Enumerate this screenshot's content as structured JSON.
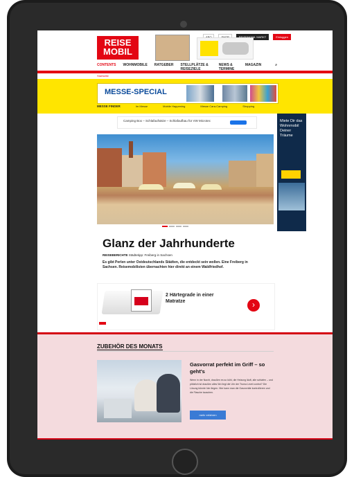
{
  "header": {
    "logo": "REISE MOBIL",
    "top_links": [
      "ABO",
      "SHOP",
      "REISEMOBIL MARKT",
      "Einloggen"
    ],
    "nav": [
      "CONTENTS",
      "WOHNMOBILE",
      "RATGEBER",
      "STELLPLÄTZE & REISEZIELE",
      "NEWS & TERMINE",
      "MAGAZIN"
    ],
    "subnav": "Startseite"
  },
  "messe": {
    "title": "MESSE-SPECIAL",
    "bar": [
      "MESSE FINDER",
      "Im Messe",
      "Mobile Happening",
      "Messe Cara-Camping",
      "Shopping"
    ]
  },
  "ad_bar": {
    "text": "Camping Box – Schlafaufsätze – Schlafaufbau für VW Microtec"
  },
  "skyscraper": {
    "text": "Miete Dir das Wohnmobil Deiner Träume"
  },
  "article": {
    "title": "Glanz der Jahrhunderte",
    "kicker_bold": "REISEBERICHTE",
    "kicker": "Städtetipp: Freiberg in Sachsen",
    "teaser": "Es gibt Perlen unter Ostdeutschlands Städten, die entdeckt sein wollen. Eine Freiberg in Sachsen. Reisemobilisten übernachten hier direkt an einem Waldfriedhof."
  },
  "ad_mattress": {
    "title": "2 Härtegrade in einer Matratze"
  },
  "zubehoer": {
    "heading": "ZUBEHÖR DES MONATS",
    "title": "Gasvorrat perfekt im Griff – so geht's",
    "text": "Wenn in der Nacht, draußen es so kühl, die Heizung läuft, alle schlafen – und plötzlich ist draußen alles Wo liegt die Uhr der Truma Level control? Die Lösung könnte hier liegen. Hier kann man die Gasvorräte kontrollieren und die Flasche tauschen.",
    "button": "mehr erfahren"
  },
  "colors": {
    "brand_red": "#e30613",
    "messe_yellow": "#ffe500",
    "highlight_border": "#d40012",
    "highlight_bg": "#f4dbde"
  }
}
